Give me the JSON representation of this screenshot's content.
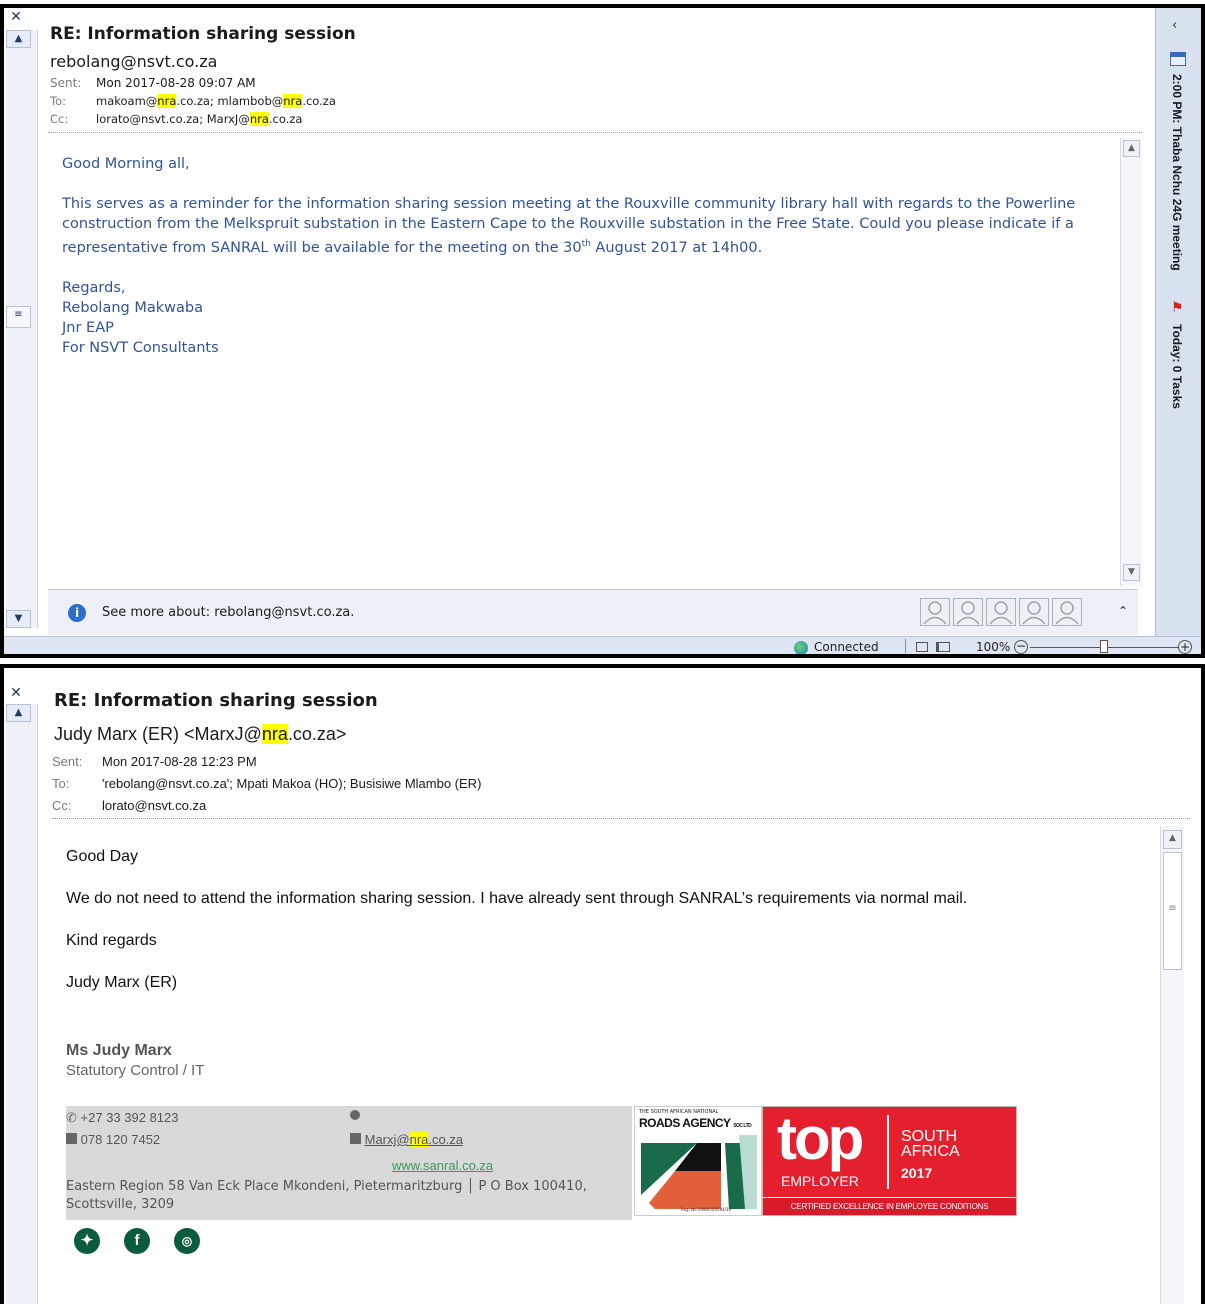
{
  "win1": {
    "subject": "RE: Information sharing session",
    "from": "rebolang@nsvt.co.za",
    "sent_label": "Sent:",
    "sent": "Mon 2017-08-28 09:07 AM",
    "to_label": "To:",
    "to": {
      "a": "makoam@",
      "b": "nra",
      "c": ".co.za; mlambob@",
      "d": "nra",
      "e": ".co.za"
    },
    "cc_label": "Cc:",
    "cc": {
      "a": "lorato@nsvt.co.za; MarxJ@",
      "b": "nra",
      "c": ".co.za"
    },
    "body": {
      "greeting": "Good Morning all,",
      "para_a": "This serves as a reminder for the information sharing session meeting at the Rouxville community library hall with regards to the Powerline construction from the Melkspruit substation in the Eastern Cape to the Rouxville substation in the Free State. Could you please indicate if a representative from SANRAL will be available for the meeting on the 30",
      "para_sup": "th",
      "para_b": " August 2017 at 14h00.",
      "sign": [
        "Regards,",
        "Rebolang Makwaba",
        "Jnr EAP",
        "For NSVT Consultants"
      ]
    },
    "people_bar": "See more about: rebolang@nsvt.co.za.",
    "todo_meeting": "2:00 PM: Thaba Nchu 24G meeting",
    "todo_tasks": "Today: 0 Tasks",
    "status": {
      "connected": "Connected",
      "zoom": "100%"
    }
  },
  "win2": {
    "subject": "RE: Information sharing session",
    "from": {
      "a": "Judy Marx (ER) <MarxJ@",
      "b": "nra",
      "c": ".co.za>"
    },
    "sent_label": "Sent:",
    "sent": "Mon 2017-08-28 12:23 PM",
    "to_label": "To:",
    "to": "'rebolang@nsvt.co.za'; Mpati Makoa (HO); Busisiwe Mlambo (ER)",
    "cc_label": "Cc:",
    "cc": "lorato@nsvt.co.za",
    "body": {
      "greeting": "Good Day",
      "para": "We do not need to attend the information sharing session. I have already sent through SANRAL’s requirements via normal mail.",
      "closing": "Kind regards",
      "name": "Judy Marx (ER)"
    },
    "signature": {
      "name": "Ms Judy Marx",
      "title": "Statutory Control / IT",
      "phone": "+27 33 392 8123",
      "mobile": "078 120 7452",
      "email": {
        "a": "Marxj@",
        "b": "nra",
        "c": ".co.za"
      },
      "web": "www.sanral.co.za",
      "address": "Eastern Region 58 Van Eck Place Mkondeni, Pietermaritzburg │ P O Box 100410, Scottsville, 3209",
      "logo_roads_top": "THE SOUTH AFRICAN NATIONAL",
      "logo_roads_main": "ROADS AGENCY",
      "logo_roads_soc": "SOC LTD",
      "logo_roads_reg": "Reg. No.1998/009584/30",
      "logo_top": "top",
      "logo_employer": "EMPLOYER",
      "logo_south": "SOUTH",
      "logo_africa": "AFRICA",
      "logo_year": "2017",
      "logo_cert": "CERTIFIED EXCELLENCE IN EMPLOYEE CONDITIONS"
    }
  },
  "colors": {
    "body_blue": "#2f5597",
    "highlight": "#ffff00",
    "top_red": "#e4202e",
    "social_green": "#0b5c3c"
  }
}
